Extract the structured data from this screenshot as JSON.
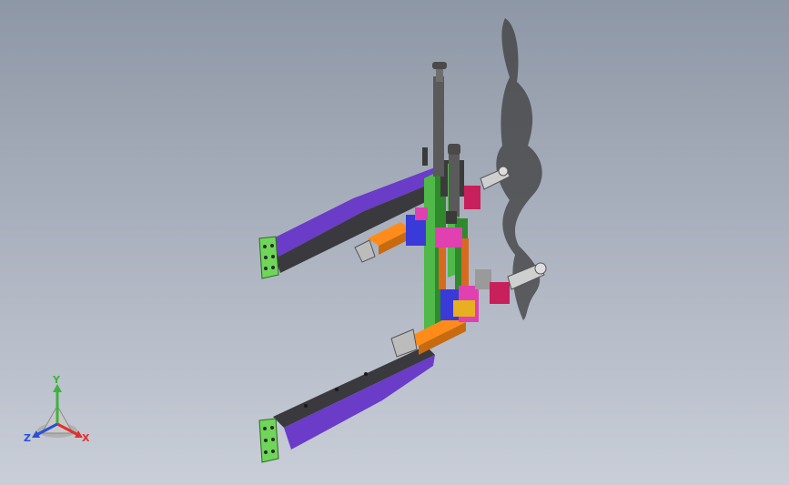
{
  "viewport": {
    "background_top": "#8e97a6",
    "background_bottom": "#c9ced8"
  },
  "model": {
    "colors": {
      "arm": "#6a3cc8",
      "arm_dark": "#3a3a3e",
      "plate": "#6fd65a",
      "column": "#4fb94a",
      "rod": "#5a5a5a",
      "slider": "#ff8c1a",
      "gripper_magenta": "#e040b0",
      "gripper_red": "#c8205a",
      "blue_block": "#3a3ad8",
      "shadow": "#3c3c3c"
    }
  },
  "triad": {
    "labels": {
      "y": "Y",
      "x": "X",
      "z": "Z"
    },
    "colors": {
      "y": "#3cb43c",
      "x": "#e03030",
      "z": "#2a50d8"
    }
  }
}
